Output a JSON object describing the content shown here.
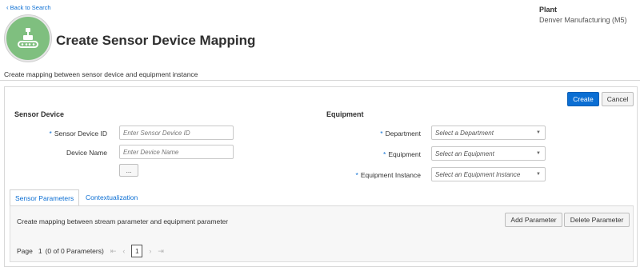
{
  "header": {
    "back_link": "Back to Search",
    "plant_label": "Plant",
    "plant_value": "Denver Manufacturing (M5)",
    "title": "Create Sensor Device Mapping",
    "subtitle": "Create mapping between sensor device and equipment instance",
    "avatar_icon": "conveyor-icon",
    "avatar_color": "#7fbf7f"
  },
  "actions": {
    "create": "Create",
    "cancel": "Cancel"
  },
  "sensor_device": {
    "title": "Sensor Device",
    "sensor_id_label": "Sensor Device ID",
    "sensor_id_placeholder": "Enter Sensor Device ID",
    "device_name_label": "Device Name",
    "device_name_placeholder": "Enter Device Name",
    "lookup_button": "..."
  },
  "equipment": {
    "title": "Equipment",
    "department_label": "Department",
    "department_value": "Select a Department",
    "equipment_label": "Equipment",
    "equipment_value": "Select an Equipment",
    "instance_label": "Equipment Instance",
    "instance_value": "Select an Equipment Instance"
  },
  "tabs": [
    {
      "label": "Sensor Parameters",
      "active": true
    },
    {
      "label": "Contextualization",
      "active": false
    }
  ],
  "parameters": {
    "description": "Create mapping between stream parameter and equipment parameter",
    "add_button": "Add Parameter",
    "delete_button": "Delete Parameter"
  },
  "pager": {
    "page_label": "Page",
    "page_value": "1",
    "count_text": "(0 of 0 Parameters)",
    "first": "⇤",
    "prev": "‹",
    "current": "1",
    "next": "›",
    "last": "⇥"
  },
  "colors": {
    "accent": "#0b6ed3",
    "required": "#0b6ed3"
  }
}
